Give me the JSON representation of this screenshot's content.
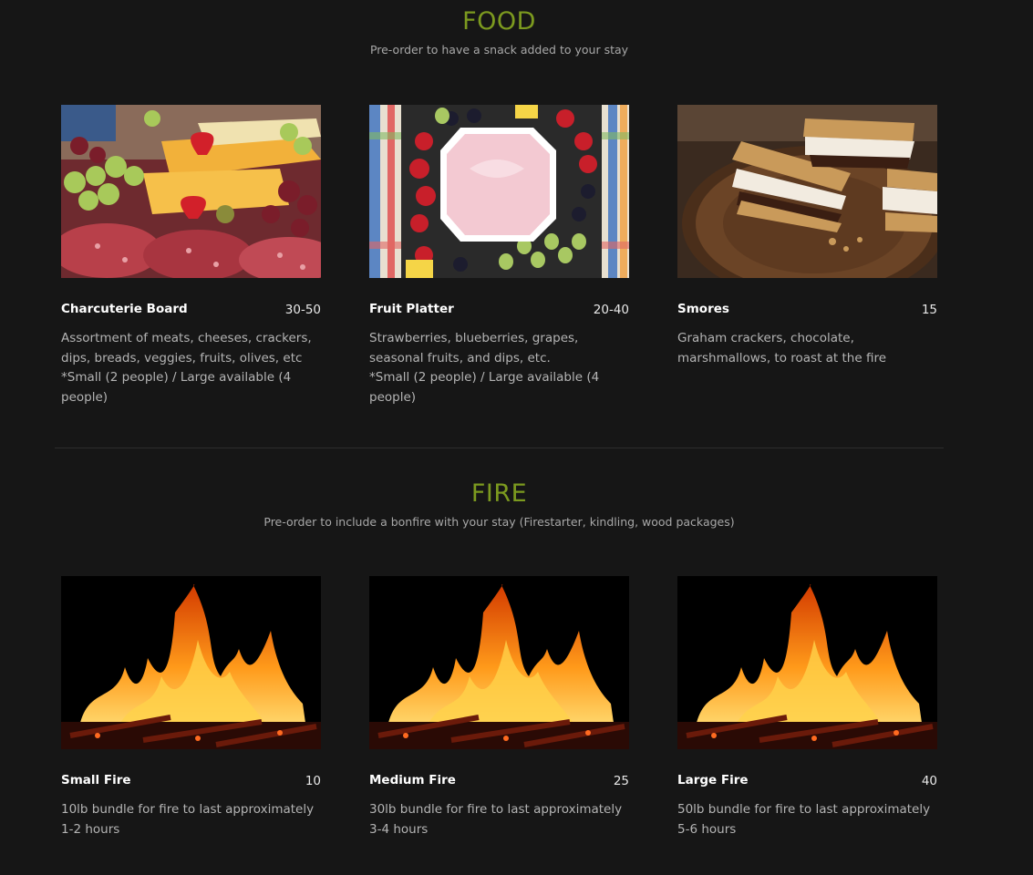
{
  "food": {
    "title": "FOOD",
    "subtitle": "Pre-order to have a snack added to your stay",
    "items": [
      {
        "name": "Charcuterie Board",
        "price": "30-50",
        "description": "Assortment of meats, cheeses, crackers, dips, breads, veggies, fruits, olives, etc\n*Small (2 people) / Large available (4 people)"
      },
      {
        "name": "Fruit Platter",
        "price": "20-40",
        "description": "Strawberries, blueberries, grapes, seasonal fruits, and dips, etc.\n*Small (2 people) / Large available (4 people)"
      },
      {
        "name": "Smores",
        "price": "15",
        "description": "Graham crackers, chocolate, marshmallows, to roast at the fire"
      }
    ]
  },
  "fire": {
    "title": "FIRE",
    "subtitle": "Pre-order to include a bonfire with your stay (Firestarter, kindling, wood packages)",
    "items": [
      {
        "name": "Small Fire",
        "price": "10",
        "description": "10lb bundle for fire to last approximately 1-2 hours"
      },
      {
        "name": "Medium Fire",
        "price": "25",
        "description": "30lb bundle for fire to last approximately 3-4 hours"
      },
      {
        "name": "Large Fire",
        "price": "40",
        "description": "50lb bundle for fire to last approximately 5-6 hours"
      }
    ]
  },
  "colors": {
    "background": "#161616",
    "heading": "#7c9a1f"
  }
}
